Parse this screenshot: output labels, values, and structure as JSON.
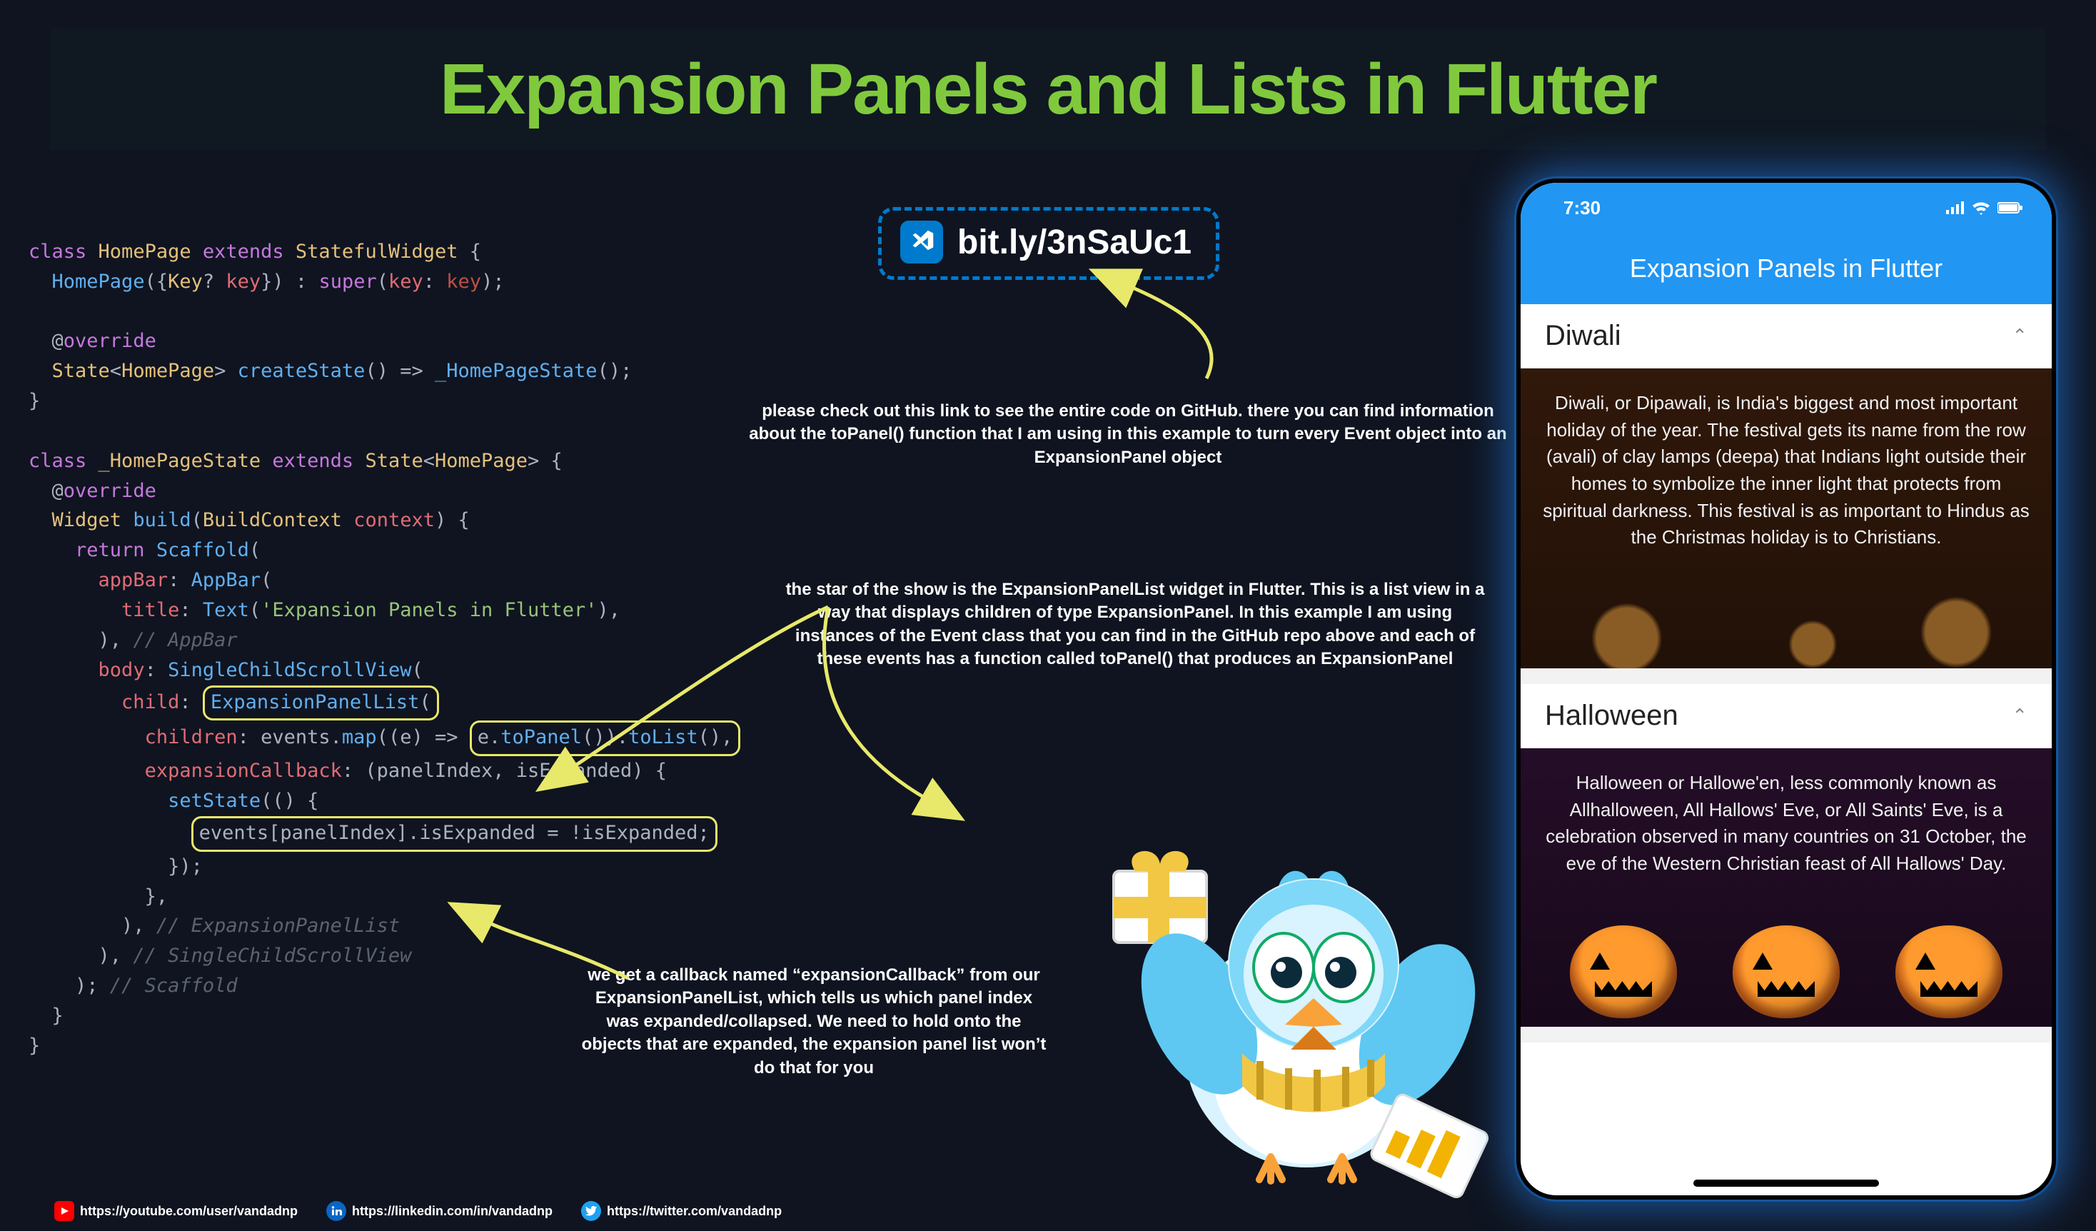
{
  "title": "Expansion Panels and Lists in Flutter",
  "link": {
    "url": "bit.ly/3nSaUc1"
  },
  "annotations": {
    "top": "please check out this link to see the entire code on GitHub. there you can find information about the toPanel() function that I am using in this example to turn every Event object into an ExpansionPanel object",
    "mid": "the star of the show is the ExpansionPanelList widget in Flutter. This is a list view in a way that displays children of type ExpansionPanel. In this example I am using instances of the Event class that you can find in the GitHub repo above and each of these events has a function called toPanel() that produces an ExpansionPanel",
    "bottom": "we get a callback named “expansionCallback” from our ExpansionPanelList, which tells us which panel index was expanded/collapsed. We need to hold onto the objects that are expanded, the expansion panel list won’t do that for you"
  },
  "code": {
    "class1_decl": [
      "class ",
      "HomePage ",
      "extends ",
      "StatefulWidget ",
      "{"
    ],
    "ctor": [
      "  ",
      "HomePage",
      "({",
      "Key",
      "? ",
      "key",
      "}) : ",
      "super",
      "(",
      "key",
      ": ",
      "key",
      ");"
    ],
    "override1": [
      "  @",
      "override"
    ],
    "createState": [
      "  ",
      "State",
      "<",
      "HomePage",
      "> ",
      "createState",
      "() => ",
      "_HomePageState",
      "();"
    ],
    "closebrace": "}",
    "class2_decl": [
      "class ",
      "_HomePageState ",
      "extends ",
      "State",
      "<",
      "HomePage",
      "> {"
    ],
    "override2": [
      "  @",
      "override"
    ],
    "build": [
      "  ",
      "Widget ",
      "build",
      "(",
      "BuildContext ",
      "context",
      ") {"
    ],
    "return": [
      "    ",
      "return ",
      "Scaffold",
      "("
    ],
    "appbar": [
      "      ",
      "appBar",
      ": ",
      "AppBar",
      "("
    ],
    "titleLine": [
      "        ",
      "title",
      ": ",
      "Text",
      "(",
      "'Expansion Panels in Flutter'",
      "),"
    ],
    "appbarClose": [
      "      ), ",
      "// AppBar"
    ],
    "body": [
      "      ",
      "body",
      ": ",
      "SingleChildScrollView",
      "("
    ],
    "child": [
      "        ",
      "child",
      ": ",
      "ExpansionPanelList",
      "("
    ],
    "children": [
      "          ",
      "children",
      ": events.",
      "map",
      "((e) => ",
      "e.",
      "toPanel",
      "()).",
      "toList",
      "(),"
    ],
    "expCb": [
      "          ",
      "expansionCallback",
      ": (panelIndex, isExpanded) {"
    ],
    "setState": [
      "            ",
      "setState",
      "(() {"
    ],
    "toggle": [
      "              ",
      "events[panelIndex].isExpanded = !isExpanded;"
    ],
    "setStateEnd": [
      "            });"
    ],
    "cbEnd": [
      "          },"
    ],
    "eplEnd": [
      "        ), ",
      "// ExpansionPanelList"
    ],
    "scsvEnd": [
      "      ), ",
      "// SingleChildScrollView"
    ],
    "scafEnd": [
      "    ); ",
      "// Scaffold"
    ],
    "buildEnd": "  }",
    "classEnd": "}"
  },
  "phone": {
    "time": "7:30",
    "appbar_title": "Expansion Panels in Flutter",
    "panels": [
      {
        "title": "Diwali",
        "body": "Diwali, or Dipawali, is India's biggest and most important holiday of the year. The festival gets its name from the row (avali) of clay lamps (deepa) that Indians light outside their homes to symbolize the inner light that protects from spiritual darkness. This festival is as important to Hindus as the Christmas holiday is to Christians."
      },
      {
        "title": "Halloween",
        "body": "Halloween or Hallowe'en, less commonly known as Allhalloween, All Hallows' Eve, or All Saints' Eve, is a celebration observed in many countries on 31 October, the eve of the Western Christian feast of All Hallows' Day."
      }
    ]
  },
  "footer": {
    "youtube": "https://youtube.com/user/vandadnp",
    "linkedin": "https://linkedin.com/in/vandadnp",
    "twitter": "https://twitter.com/vandadnp"
  }
}
